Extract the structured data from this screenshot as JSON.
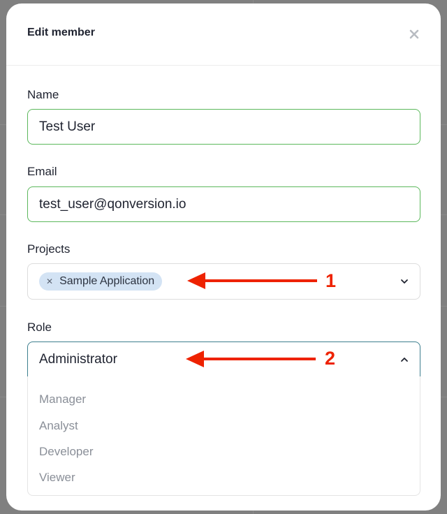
{
  "modal": {
    "title": "Edit member",
    "close_icon": "close-icon"
  },
  "form": {
    "name": {
      "label": "Name",
      "value": "Test User"
    },
    "email": {
      "label": "Email",
      "value": "test_user@qonversion.io"
    },
    "projects": {
      "label": "Projects",
      "selected": [
        {
          "label": "Sample Application"
        }
      ],
      "chevron_icon": "chevron-down-icon"
    },
    "role": {
      "label": "Role",
      "value": "Administrator",
      "chevron_icon": "chevron-up-icon",
      "options": [
        {
          "label": "Manager"
        },
        {
          "label": "Analyst"
        },
        {
          "label": "Developer"
        },
        {
          "label": "Viewer"
        }
      ]
    }
  },
  "annotations": [
    {
      "number": "1"
    },
    {
      "number": "2"
    }
  ],
  "colors": {
    "accent_green": "#5cb85c",
    "chip_bg": "#d3e3f4",
    "focus_border": "#3d7f8e",
    "annotation_red": "#ee2200"
  }
}
